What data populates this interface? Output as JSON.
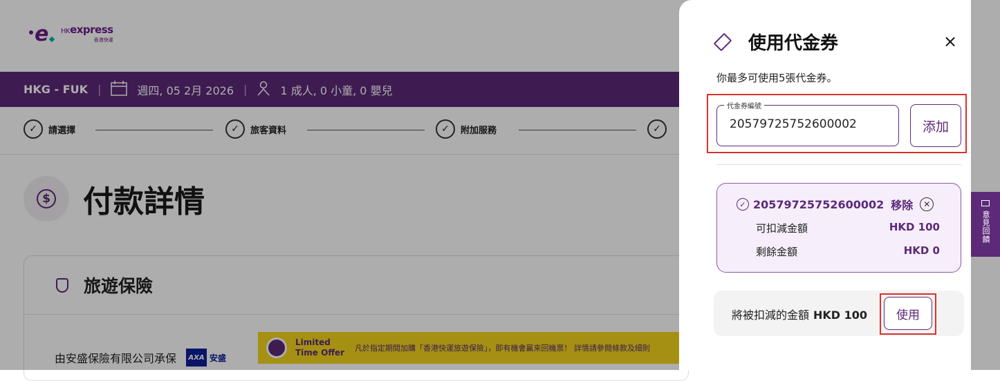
{
  "header": {
    "logo_text": "HKexpress",
    "logo_prefix": "HK",
    "logo_main": "express",
    "logo_zh": "香港快運"
  },
  "trip": {
    "route": "HKG - FUK",
    "date": "週四, 05 2月 2026",
    "passengers": "1 成人, 0 小童, 0 嬰兒"
  },
  "steps": [
    "請選擇",
    "旅客資料",
    "附加服務"
  ],
  "page": {
    "title": "付款詳情"
  },
  "insurance": {
    "title": "旅遊保險",
    "underwriter": "由安盛保險有限公司承保",
    "axa_logo": "AXA",
    "axa_zh": "安盛",
    "promo_tag": "Limited Time Offer",
    "promo_text": "凡於指定期間加購「香港快運旅遊保險」，即有機會贏來回機票！ 詳情請參閱條款及細則"
  },
  "voucher_drawer": {
    "title": "使用代金券",
    "close_icon": "×",
    "hint": "你最多可使用5張代金券。",
    "field_label": "代金券編號",
    "field_value": "20579725752600002",
    "add_label": "添加",
    "applied": {
      "code": "20579725752600002",
      "remove_label": "移除",
      "deductible_label": "可扣減金額",
      "deductible_value": "HKD 100",
      "remaining_label": "剩餘金額",
      "remaining_value": "HKD 0"
    },
    "summary_label": "將被扣減的金額",
    "summary_amount": "HKD 100",
    "use_label": "使用"
  },
  "feedback": {
    "label": "意見回饋"
  },
  "colors": {
    "brand_purple": "#5c2a79",
    "highlight_red": "#d9302c",
    "promo_yellow": "#f3d51c"
  }
}
